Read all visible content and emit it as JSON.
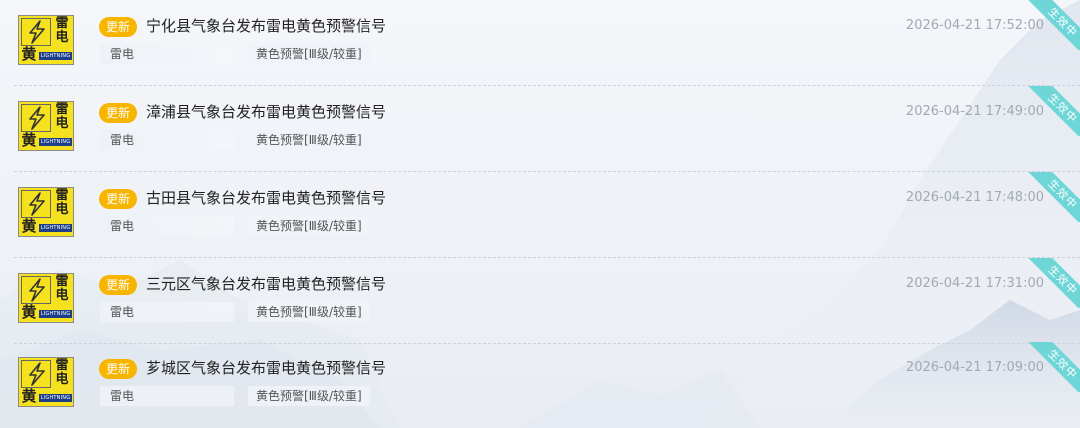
{
  "icon": {
    "char_lei": "雷",
    "char_dian": "电",
    "char_huang": "黄",
    "en_text": "LIGHTNING"
  },
  "warnings": [
    {
      "badge": "更新",
      "title": "宁化县气象台发布雷电黄色预警信号",
      "type": "雷电",
      "level": "黄色预警[Ⅲ级/较重]",
      "time": "2026-04-21 17:52:00",
      "status": "生效中"
    },
    {
      "badge": "更新",
      "title": "漳浦县气象台发布雷电黄色预警信号",
      "type": "雷电",
      "level": "黄色预警[Ⅲ级/较重]",
      "time": "2026-04-21 17:49:00",
      "status": "生效中"
    },
    {
      "badge": "更新",
      "title": "古田县气象台发布雷电黄色预警信号",
      "type": "雷电",
      "level": "黄色预警[Ⅲ级/较重]",
      "time": "2026-04-21 17:48:00",
      "status": "生效中"
    },
    {
      "badge": "更新",
      "title": "三元区气象台发布雷电黄色预警信号",
      "type": "雷电",
      "level": "黄色预警[Ⅲ级/较重]",
      "time": "2026-04-21 17:31:00",
      "status": "生效中"
    },
    {
      "badge": "更新",
      "title": "芗城区气象台发布雷电黄色预警信号",
      "type": "雷电",
      "level": "黄色预警[Ⅲ级/较重]",
      "time": "2026-04-21 17:09:00",
      "status": "生效中"
    }
  ],
  "colors": {
    "badge": "#f7b500",
    "ribbon": "#6fd6d8",
    "icon_yellow": "#f5e11e",
    "icon_en_bar": "#1d3f8a",
    "time_text": "#a3a9b3"
  }
}
